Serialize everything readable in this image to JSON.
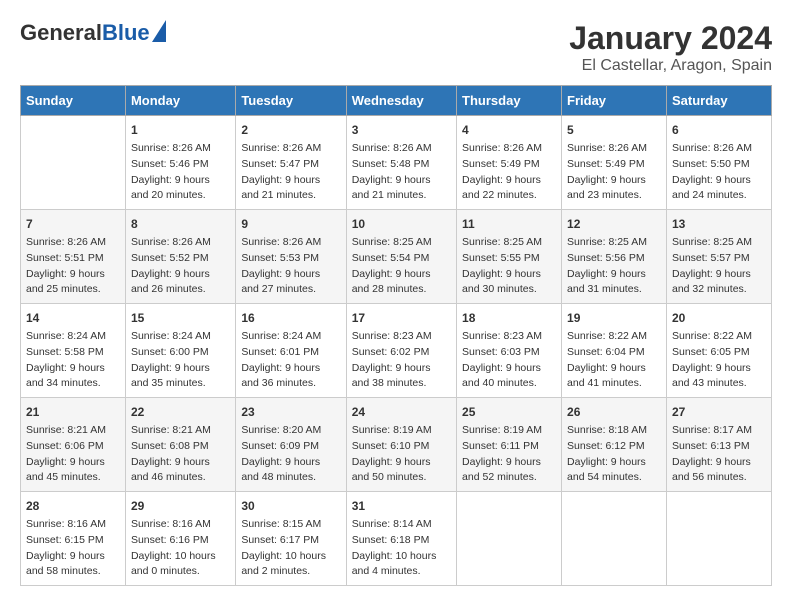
{
  "header": {
    "logo_general": "General",
    "logo_blue": "Blue",
    "title": "January 2024",
    "subtitle": "El Castellar, Aragon, Spain"
  },
  "days_of_week": [
    "Sunday",
    "Monday",
    "Tuesday",
    "Wednesday",
    "Thursday",
    "Friday",
    "Saturday"
  ],
  "weeks": [
    [
      {
        "day": "",
        "content": ""
      },
      {
        "day": "1",
        "content": "Sunrise: 8:26 AM\nSunset: 5:46 PM\nDaylight: 9 hours\nand 20 minutes."
      },
      {
        "day": "2",
        "content": "Sunrise: 8:26 AM\nSunset: 5:47 PM\nDaylight: 9 hours\nand 21 minutes."
      },
      {
        "day": "3",
        "content": "Sunrise: 8:26 AM\nSunset: 5:48 PM\nDaylight: 9 hours\nand 21 minutes."
      },
      {
        "day": "4",
        "content": "Sunrise: 8:26 AM\nSunset: 5:49 PM\nDaylight: 9 hours\nand 22 minutes."
      },
      {
        "day": "5",
        "content": "Sunrise: 8:26 AM\nSunset: 5:49 PM\nDaylight: 9 hours\nand 23 minutes."
      },
      {
        "day": "6",
        "content": "Sunrise: 8:26 AM\nSunset: 5:50 PM\nDaylight: 9 hours\nand 24 minutes."
      }
    ],
    [
      {
        "day": "7",
        "content": "Sunrise: 8:26 AM\nSunset: 5:51 PM\nDaylight: 9 hours\nand 25 minutes."
      },
      {
        "day": "8",
        "content": "Sunrise: 8:26 AM\nSunset: 5:52 PM\nDaylight: 9 hours\nand 26 minutes."
      },
      {
        "day": "9",
        "content": "Sunrise: 8:26 AM\nSunset: 5:53 PM\nDaylight: 9 hours\nand 27 minutes."
      },
      {
        "day": "10",
        "content": "Sunrise: 8:25 AM\nSunset: 5:54 PM\nDaylight: 9 hours\nand 28 minutes."
      },
      {
        "day": "11",
        "content": "Sunrise: 8:25 AM\nSunset: 5:55 PM\nDaylight: 9 hours\nand 30 minutes."
      },
      {
        "day": "12",
        "content": "Sunrise: 8:25 AM\nSunset: 5:56 PM\nDaylight: 9 hours\nand 31 minutes."
      },
      {
        "day": "13",
        "content": "Sunrise: 8:25 AM\nSunset: 5:57 PM\nDaylight: 9 hours\nand 32 minutes."
      }
    ],
    [
      {
        "day": "14",
        "content": "Sunrise: 8:24 AM\nSunset: 5:58 PM\nDaylight: 9 hours\nand 34 minutes."
      },
      {
        "day": "15",
        "content": "Sunrise: 8:24 AM\nSunset: 6:00 PM\nDaylight: 9 hours\nand 35 minutes."
      },
      {
        "day": "16",
        "content": "Sunrise: 8:24 AM\nSunset: 6:01 PM\nDaylight: 9 hours\nand 36 minutes."
      },
      {
        "day": "17",
        "content": "Sunrise: 8:23 AM\nSunset: 6:02 PM\nDaylight: 9 hours\nand 38 minutes."
      },
      {
        "day": "18",
        "content": "Sunrise: 8:23 AM\nSunset: 6:03 PM\nDaylight: 9 hours\nand 40 minutes."
      },
      {
        "day": "19",
        "content": "Sunrise: 8:22 AM\nSunset: 6:04 PM\nDaylight: 9 hours\nand 41 minutes."
      },
      {
        "day": "20",
        "content": "Sunrise: 8:22 AM\nSunset: 6:05 PM\nDaylight: 9 hours\nand 43 minutes."
      }
    ],
    [
      {
        "day": "21",
        "content": "Sunrise: 8:21 AM\nSunset: 6:06 PM\nDaylight: 9 hours\nand 45 minutes."
      },
      {
        "day": "22",
        "content": "Sunrise: 8:21 AM\nSunset: 6:08 PM\nDaylight: 9 hours\nand 46 minutes."
      },
      {
        "day": "23",
        "content": "Sunrise: 8:20 AM\nSunset: 6:09 PM\nDaylight: 9 hours\nand 48 minutes."
      },
      {
        "day": "24",
        "content": "Sunrise: 8:19 AM\nSunset: 6:10 PM\nDaylight: 9 hours\nand 50 minutes."
      },
      {
        "day": "25",
        "content": "Sunrise: 8:19 AM\nSunset: 6:11 PM\nDaylight: 9 hours\nand 52 minutes."
      },
      {
        "day": "26",
        "content": "Sunrise: 8:18 AM\nSunset: 6:12 PM\nDaylight: 9 hours\nand 54 minutes."
      },
      {
        "day": "27",
        "content": "Sunrise: 8:17 AM\nSunset: 6:13 PM\nDaylight: 9 hours\nand 56 minutes."
      }
    ],
    [
      {
        "day": "28",
        "content": "Sunrise: 8:16 AM\nSunset: 6:15 PM\nDaylight: 9 hours\nand 58 minutes."
      },
      {
        "day": "29",
        "content": "Sunrise: 8:16 AM\nSunset: 6:16 PM\nDaylight: 10 hours\nand 0 minutes."
      },
      {
        "day": "30",
        "content": "Sunrise: 8:15 AM\nSunset: 6:17 PM\nDaylight: 10 hours\nand 2 minutes."
      },
      {
        "day": "31",
        "content": "Sunrise: 8:14 AM\nSunset: 6:18 PM\nDaylight: 10 hours\nand 4 minutes."
      },
      {
        "day": "",
        "content": ""
      },
      {
        "day": "",
        "content": ""
      },
      {
        "day": "",
        "content": ""
      }
    ]
  ]
}
